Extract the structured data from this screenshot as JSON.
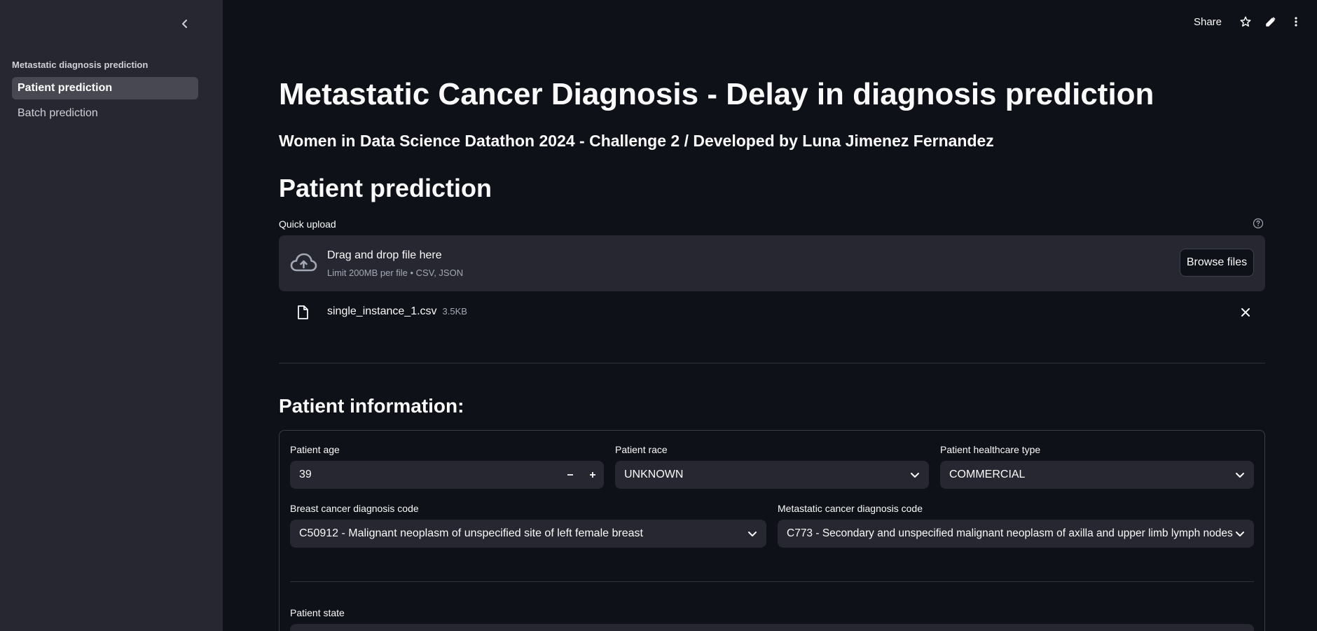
{
  "sidebar": {
    "section_title": "Metastatic diagnosis prediction",
    "items": [
      {
        "label": "Patient prediction",
        "active": true
      },
      {
        "label": "Batch prediction",
        "active": false
      }
    ]
  },
  "toolbar": {
    "share_label": "Share",
    "icons": [
      "star-icon",
      "pencil-icon",
      "more-vertical-icon"
    ]
  },
  "main": {
    "title": "Metastatic Cancer Diagnosis - Delay in diagnosis prediction",
    "subtitle": "Women in Data Science Datathon 2024 - Challenge 2 / Developed by Luna Jimenez Fernandez",
    "section_title": "Patient prediction",
    "upload": {
      "label": "Quick upload",
      "drop_title": "Drag and drop file here",
      "drop_sub": "Limit 200MB per file • CSV, JSON",
      "browse_label": "Browse files",
      "file_name": "single_instance_1.csv",
      "file_size": "3.5KB"
    },
    "patient_info_title": "Patient information:",
    "form": {
      "age": {
        "label": "Patient age",
        "value": "39"
      },
      "race": {
        "label": "Patient race",
        "value": "UNKNOWN"
      },
      "healthcare": {
        "label": "Patient healthcare type",
        "value": "COMMERCIAL"
      },
      "breast_code": {
        "label": "Breast cancer diagnosis code",
        "value": "C50912 - Malignant neoplasm of unspecified site of left female breast"
      },
      "meta_code": {
        "label": "Metastatic cancer diagnosis code",
        "value": "C773 - Secondary and unspecified malignant neoplasm of axilla and upper limb lymph nodes"
      },
      "state": {
        "label": "Patient state"
      }
    }
  },
  "colors": {
    "background": "#0e1117",
    "sidebar": "#262730",
    "input": "#262730",
    "active_nav": "#474852",
    "text": "#fafafa",
    "muted": "#a3a8b4"
  }
}
